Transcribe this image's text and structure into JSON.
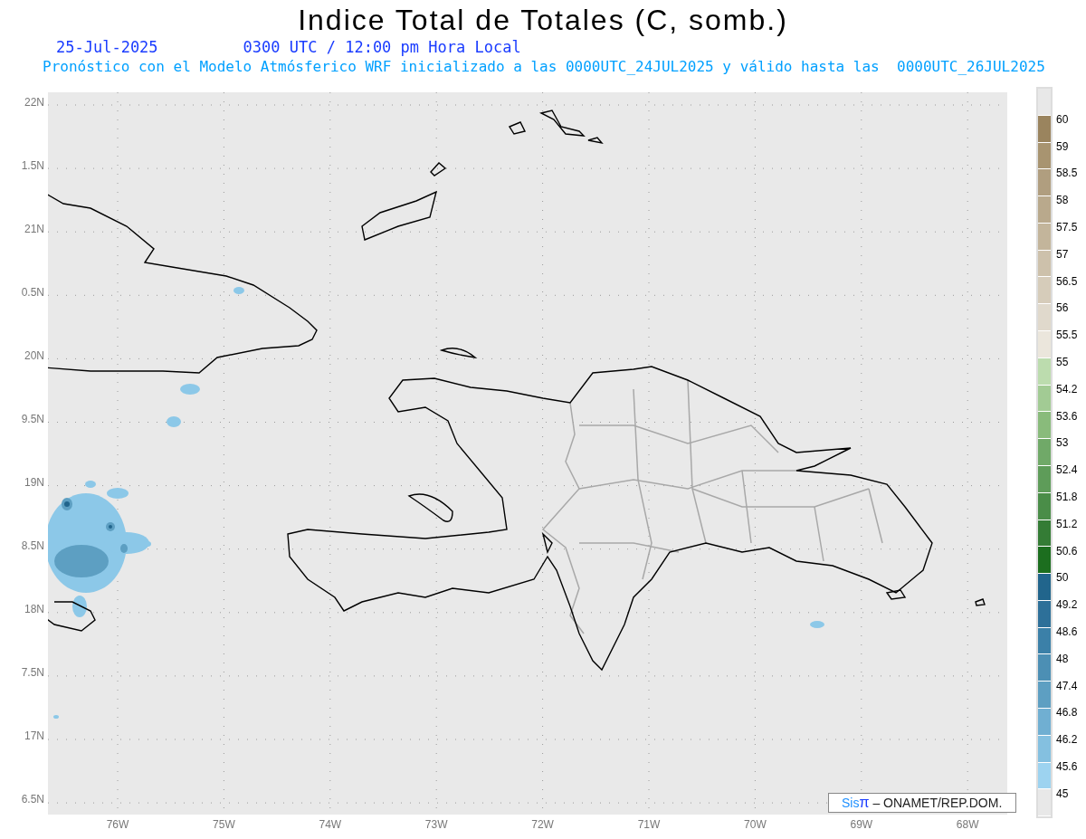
{
  "title": "Indice Total de Totales (C, somb.)",
  "date": "25-Jul-2025",
  "time": "0300 UTC / 12:00 pm Hora Local",
  "subtitle": "Pronóstico con el Modelo Atmósferico WRF inicializado a las 0000UTC_24JUL2025 y válido hasta las  0000UTC_26JUL2025",
  "lat_labels": [
    "22N",
    "1.5N",
    "21N",
    "0.5N",
    "20N",
    "9.5N",
    "19N",
    "8.5N",
    "18N",
    "7.5N",
    "17N",
    "6.5N"
  ],
  "lon_labels": [
    "76W",
    "75W",
    "74W",
    "73W",
    "72W",
    "71W",
    "70W",
    "69W",
    "68W"
  ],
  "credit": {
    "brand": "Sis",
    "symbol": "π",
    "text": "– ONAMET/REP.DOM."
  },
  "colorbar": {
    "bins": [
      {
        "color": "#e8e8e8"
      },
      {
        "color": "#9a845e"
      },
      {
        "color": "#a89470"
      },
      {
        "color": "#b09e7f"
      },
      {
        "color": "#b9a98c"
      },
      {
        "color": "#c3b59b"
      },
      {
        "color": "#cdc1ab"
      },
      {
        "color": "#d6ccba"
      },
      {
        "color": "#e0d9cc"
      },
      {
        "color": "#ebe6dc"
      },
      {
        "color": "#bcdcae"
      },
      {
        "color": "#a2cb94"
      },
      {
        "color": "#89bb7b"
      },
      {
        "color": "#70a968"
      },
      {
        "color": "#5e9c59"
      },
      {
        "color": "#4a8d48"
      },
      {
        "color": "#347c35"
      },
      {
        "color": "#1c6e1f"
      },
      {
        "color": "#21658c"
      },
      {
        "color": "#2d7099"
      },
      {
        "color": "#3b80a8"
      },
      {
        "color": "#4c8fb4"
      },
      {
        "color": "#5d9fc2"
      },
      {
        "color": "#70afd2"
      },
      {
        "color": "#84c0e0"
      },
      {
        "color": "#9dd3f0"
      },
      {
        "color": "#e8e8e8"
      }
    ],
    "labels": [
      "60",
      "59",
      "58.5",
      "58",
      "57.5",
      "57",
      "56.5",
      "56",
      "55.5",
      "55",
      "54.2",
      "53.6",
      "53",
      "52.4",
      "51.8",
      "51.2",
      "50.6",
      "50",
      "49.2",
      "48.6",
      "48",
      "47.4",
      "46.8",
      "46.2",
      "45.6",
      "45"
    ]
  }
}
